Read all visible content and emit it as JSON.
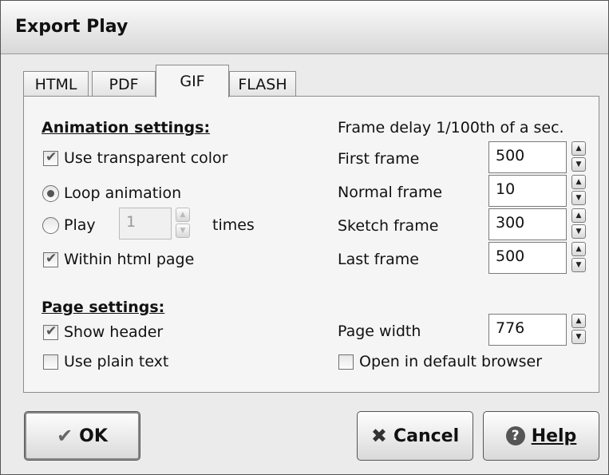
{
  "window": {
    "title": "Export Play"
  },
  "tabs": [
    {
      "label": "HTML"
    },
    {
      "label": "PDF"
    },
    {
      "label": "GIF"
    },
    {
      "label": "FLASH"
    }
  ],
  "animation": {
    "heading": "Animation settings:",
    "transparent_label": "Use transparent color",
    "loop_label": "Loop animation",
    "play_label": "Play",
    "play_times_value": "1",
    "times_label": "times",
    "within_html_label": "Within html page"
  },
  "frames": {
    "heading": "Frame delay 1/100th of a sec.",
    "first_label": "First frame",
    "first_value": "500",
    "normal_label": "Normal frame",
    "normal_value": "10",
    "sketch_label": "Sketch frame",
    "sketch_value": "300",
    "last_label": "Last frame",
    "last_value": "500"
  },
  "page": {
    "heading": "Page settings:",
    "show_header_label": "Show header",
    "plain_text_label": "Use plain text",
    "width_label": "Page width",
    "width_value": "776",
    "open_browser_label": "Open in default browser"
  },
  "buttons": {
    "ok_label": "OK",
    "cancel_label": "Cancel",
    "help_label": "Help"
  },
  "icons": {
    "ok": "checkmark-icon",
    "cancel": "x-icon",
    "help": "question-circle-icon"
  }
}
